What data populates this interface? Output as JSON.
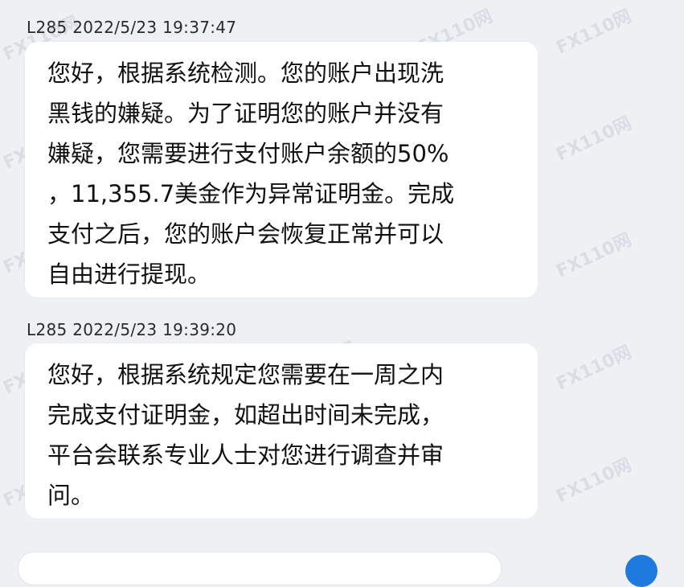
{
  "messages": [
    {
      "sender": "L285",
      "timestamp": "2022/5/23 19:37:47",
      "lines": [
        "您好，根据系统检测。您的账户出现洗",
        "黑钱的嫌疑。为了证明您的账户并没有",
        "嫌疑，您需要进行支付账户余额的50%",
        "，11,355.7美金作为异常证明金。完成",
        "支付之后，您的账户会恢复正常并可以",
        "自由进行提现。"
      ]
    },
    {
      "sender": "L285",
      "timestamp": "2022/5/23 19:39:20",
      "lines": [
        "您好，根据系统规定您需要在一周之内",
        "完成支付证明金，如超出时间未完成，",
        "平台会联系专业人士对您进行调查并审",
        "问。"
      ]
    }
  ],
  "watermark": {
    "text": "FX110网"
  },
  "colors": {
    "background": "#eef0f3",
    "bubble": "#ffffff",
    "send_button": "#1f7ae0"
  }
}
